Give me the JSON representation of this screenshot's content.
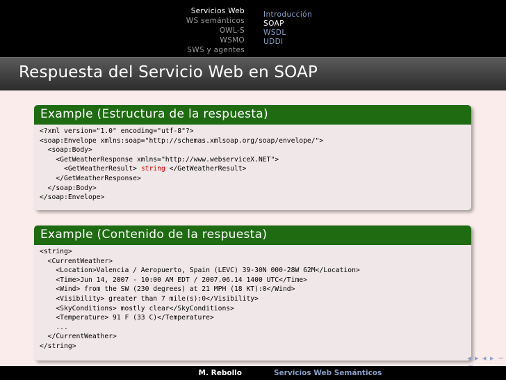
{
  "nav": {
    "sections": [
      "Servicios Web",
      "WS semánticos",
      "OWL-S",
      "WSMO",
      "SWS y agentes"
    ],
    "active_section": 0,
    "subsections": [
      "Introducción",
      "SOAP",
      "WSDL",
      "UDDI"
    ],
    "active_subsection": 1
  },
  "frame_title": "Respuesta del Servicio Web en SOAP",
  "examples": [
    {
      "title": "Example (Estructura de la respuesta)",
      "lines": [
        {
          "text": "<?xml version=\"1.0\" encoding=\"utf-8\"?>"
        },
        {
          "text": "<soap:Envelope xmlns:soap=\"http://schemas.xmlsoap.org/soap/envelope/\">"
        },
        {
          "text": "  <soap:Body>"
        },
        {
          "text": "    <GetWeatherResponse xmlns=\"http://www.webserviceX.NET\">"
        },
        {
          "pre": "      <GetWeatherResult> ",
          "highlight": "string",
          "post": " </GetWeatherResult>"
        },
        {
          "text": "    </GetWeatherResponse>"
        },
        {
          "text": "  </soap:Body>"
        },
        {
          "text": "</soap:Envelope>"
        }
      ]
    },
    {
      "title": "Example (Contenido de la respuesta)",
      "lines": [
        {
          "text": "<string>"
        },
        {
          "text": "  <CurrentWeather>"
        },
        {
          "text": "    <Location>Valencia / Aeropuerto, Spain (LEVC) 39-30N 000-28W 62M</Location>"
        },
        {
          "text": "    <Time>Jun 14, 2007 - 10:00 AM EDT / 2007.06.14 1400 UTC</Time>"
        },
        {
          "text": "    <Wind> from the SW (230 degrees) at 21 MPH (18 KT):0</Wind>"
        },
        {
          "text": "    <Visibility> greater than 7 mile(s):0</Visibility>"
        },
        {
          "text": "    <SkyConditions> mostly clear</SkyConditions>"
        },
        {
          "text": "    <Temperature> 91 F (33 C)</Temperature>"
        },
        {
          "text": "    ..."
        },
        {
          "text": "  </CurrentWeather>"
        },
        {
          "text": "</string>"
        }
      ]
    }
  ],
  "footer": {
    "author": "M. Rebollo",
    "course": "Servicios Web Semánticos"
  },
  "nav_symbols": "◂ ▸ ◂ ▸ ∽ ⊂"
}
